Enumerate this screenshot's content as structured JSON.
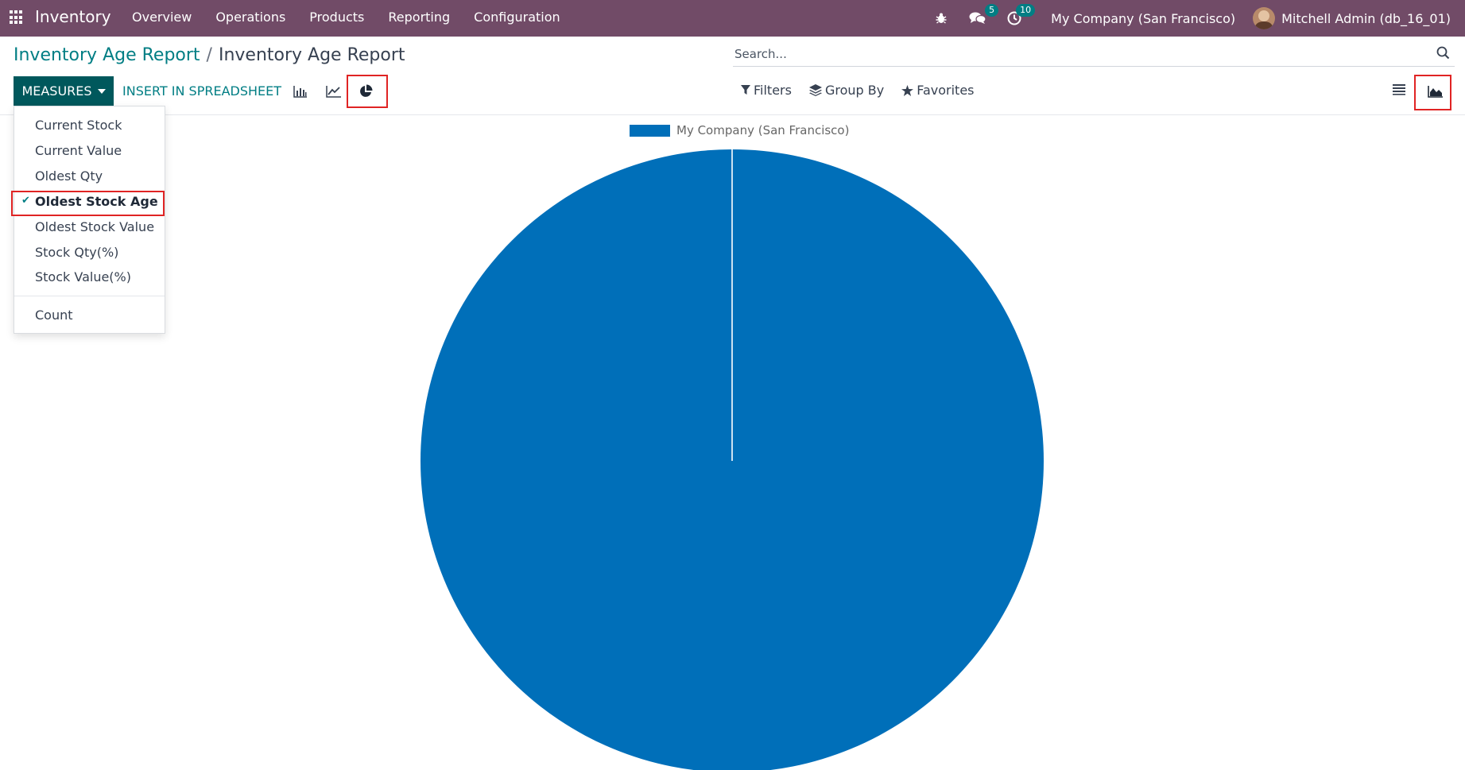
{
  "navbar": {
    "brand": "Inventory",
    "menu": [
      "Overview",
      "Operations",
      "Products",
      "Reporting",
      "Configuration"
    ],
    "messages_count": "5",
    "activities_count": "10",
    "company": "My Company (San Francisco)",
    "user": "Mitchell Admin (db_16_01)",
    "color": "#714b67"
  },
  "breadcrumb": {
    "parent": "Inventory Age Report",
    "separator": "/",
    "current": "Inventory Age Report"
  },
  "search": {
    "placeholder": "Search..."
  },
  "toolbar": {
    "measures_label": "MEASURES",
    "spreadsheet_label": "INSERT IN SPREADSHEET",
    "filters_label": "Filters",
    "group_by_label": "Group By",
    "favorites_label": "Favorites"
  },
  "measures_menu": {
    "items": [
      {
        "label": "Current Stock",
        "selected": false
      },
      {
        "label": "Current Value",
        "selected": false
      },
      {
        "label": "Oldest Qty",
        "selected": false
      },
      {
        "label": "Oldest Stock Age",
        "selected": true
      },
      {
        "label": "Oldest Stock Value",
        "selected": false
      },
      {
        "label": "Stock Qty(%)",
        "selected": false
      },
      {
        "label": "Stock Value(%)",
        "selected": false
      }
    ],
    "count_label": "Count",
    "check_mark": "✔"
  },
  "chart_data": {
    "type": "pie",
    "legend": [
      "My Company (San Francisco)"
    ],
    "labels": [
      "My Company (San Francisco)"
    ],
    "values": [
      100
    ],
    "colors": [
      "#006fb9"
    ],
    "legend_position": "top"
  },
  "colors": {
    "accent": "#017e84",
    "primary_button": "#00585c",
    "highlight_box": "#e02424",
    "pie": "#006fb9"
  }
}
